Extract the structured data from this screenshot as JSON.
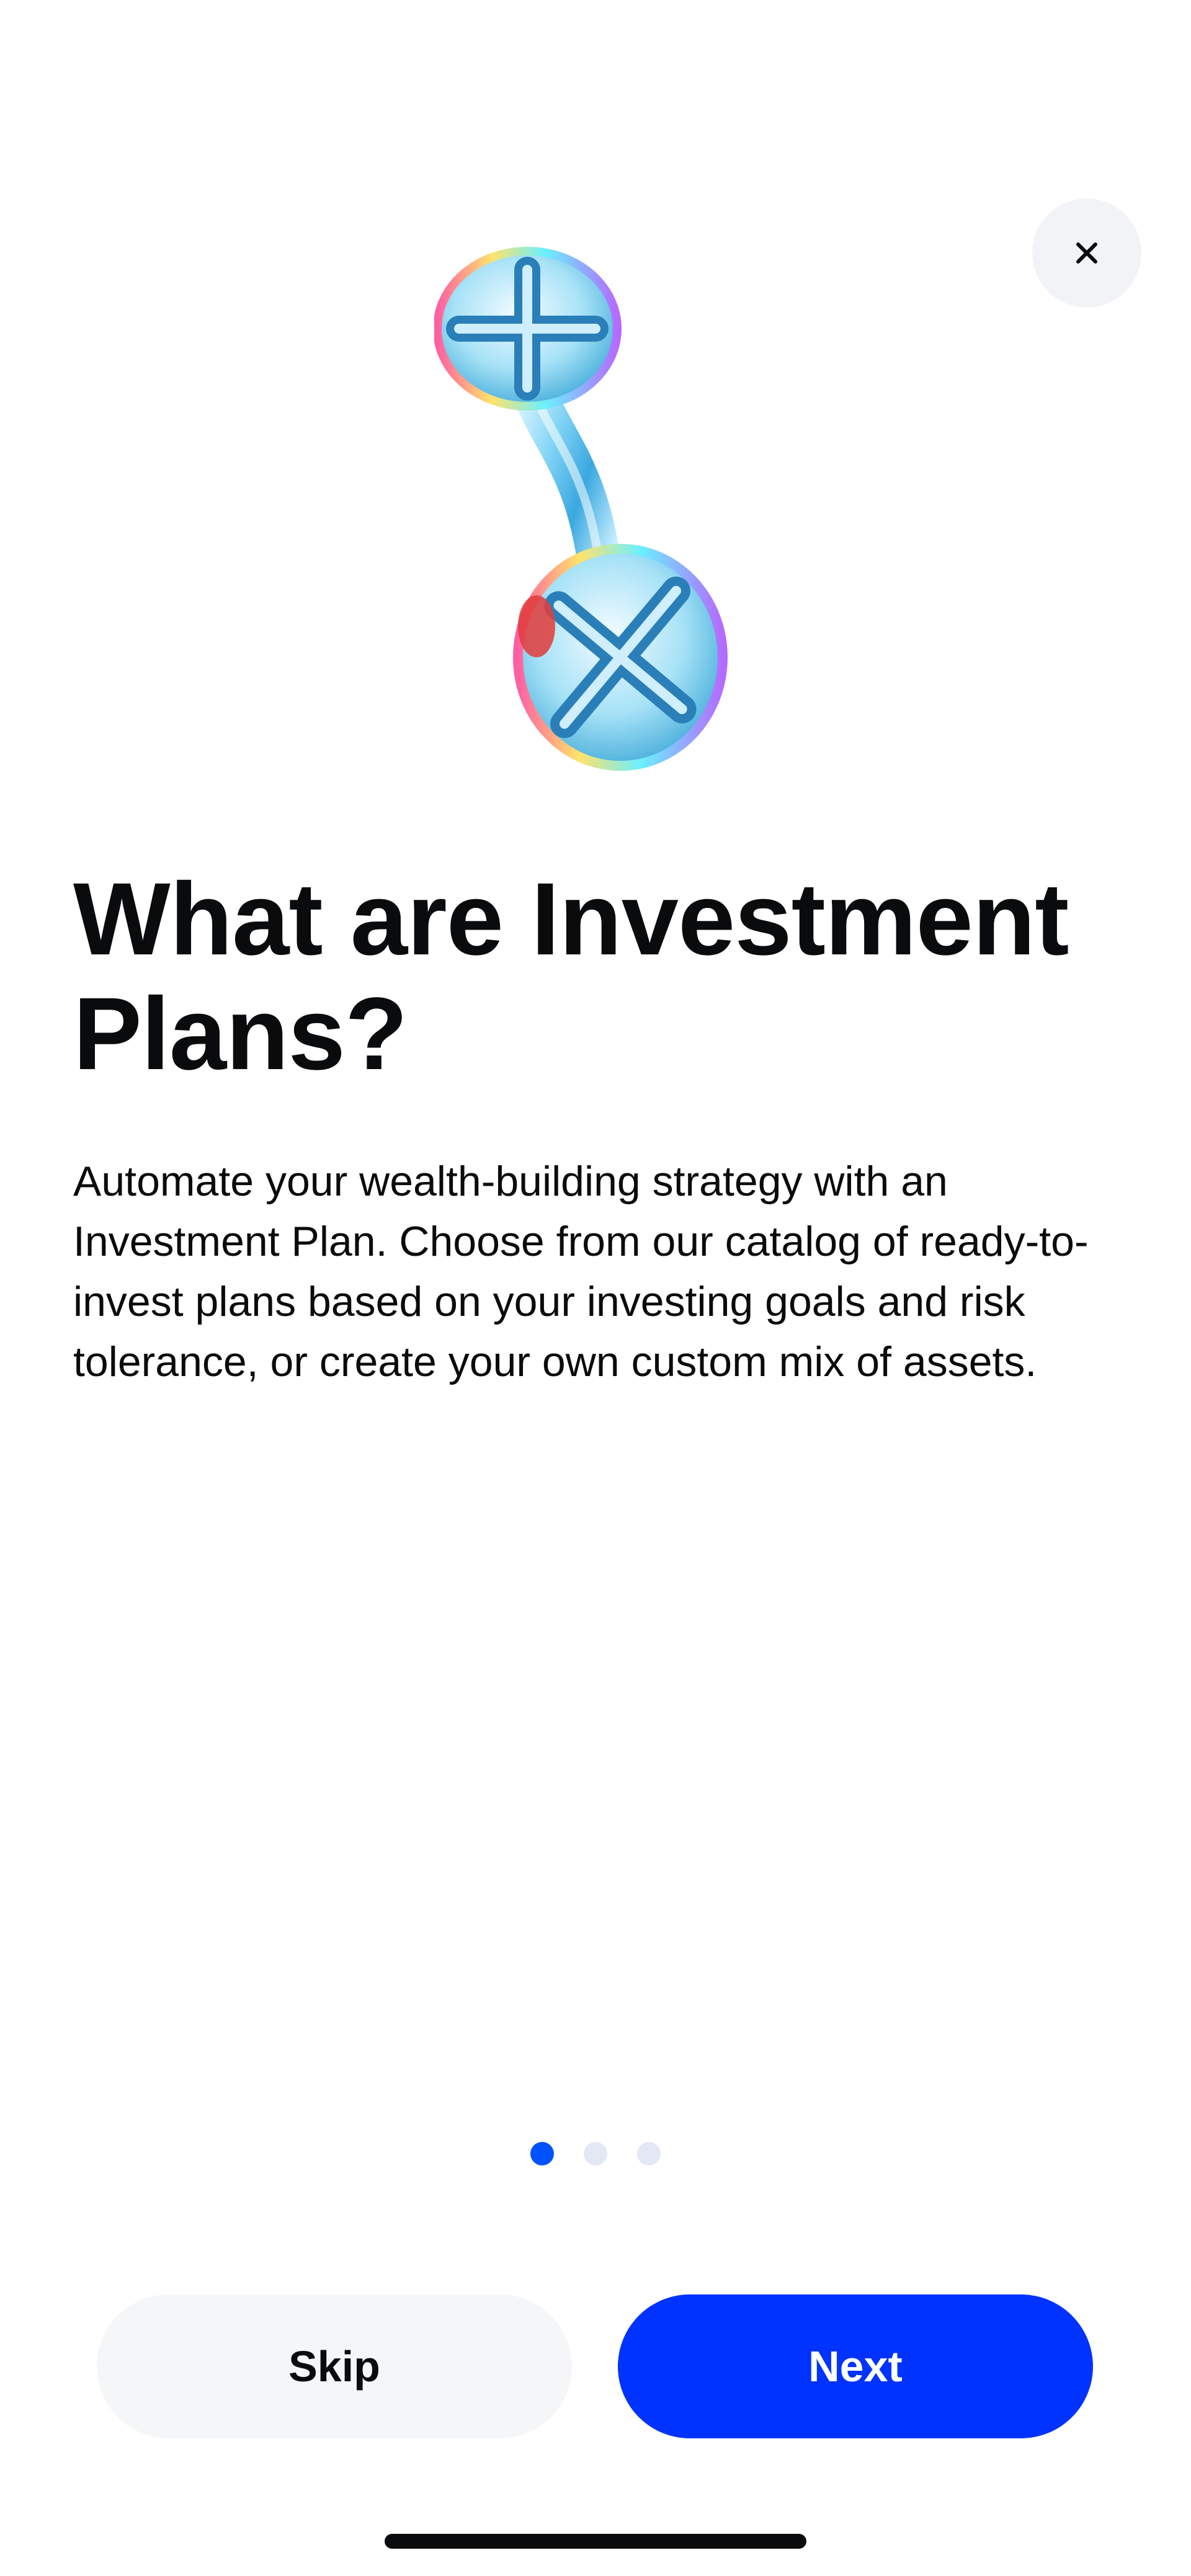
{
  "close": {
    "icon": "close-icon"
  },
  "hero": {
    "icon": "investment-plan-illustration"
  },
  "heading": {
    "line1": "What are Investment",
    "line2": "Plans?"
  },
  "description": "Automate your wealth-building strategy with an Investment Plan. Choose from our catalog of ready-to-invest plans based on your investing goals and risk tolerance, or create your own custom mix of assets.",
  "pagination": {
    "total": 3,
    "active": 1
  },
  "buttons": {
    "skip_label": "Skip",
    "next_label": "Next"
  },
  "colors": {
    "accent": "#0033ff",
    "dot_active": "#0052ff",
    "dot_inactive": "#e4e8f5",
    "skip_bg": "#f5f6f8"
  }
}
